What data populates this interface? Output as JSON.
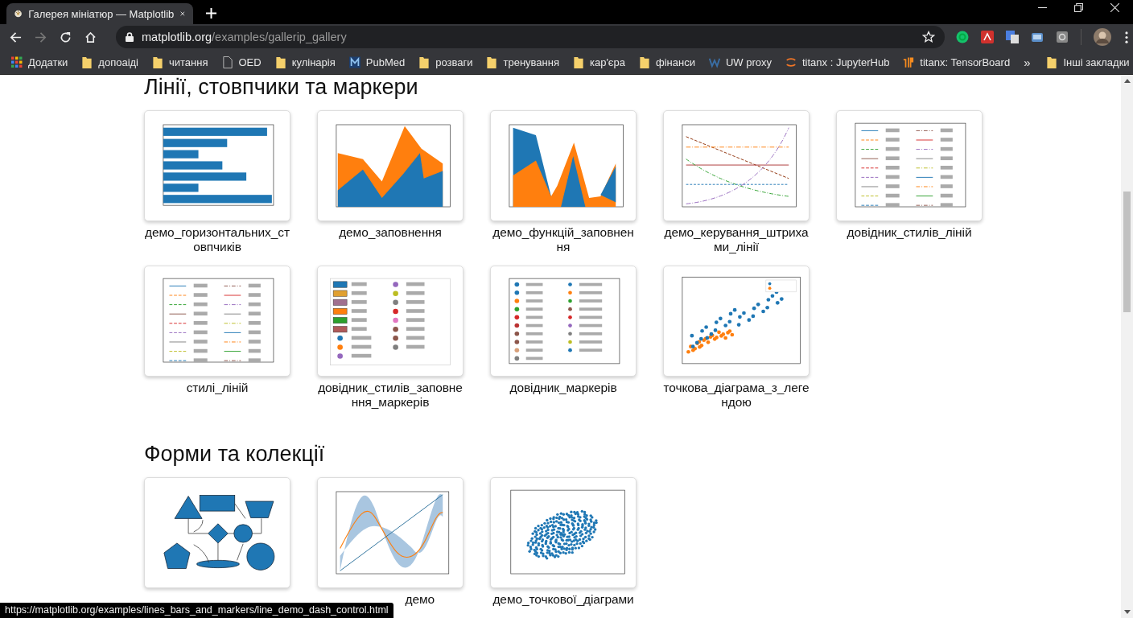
{
  "tab": {
    "title": "Галерея мініатюр — Matplotlib",
    "selected": true
  },
  "address": {
    "host": "matplotlib.org",
    "path": "/examples/gallerip_gallery"
  },
  "bookmarks": [
    {
      "kind": "apps",
      "label": "Додатки"
    },
    {
      "kind": "folder",
      "label": "допоаіді"
    },
    {
      "kind": "folder",
      "label": "читання"
    },
    {
      "kind": "page",
      "label": "OED"
    },
    {
      "kind": "folder",
      "label": "кулінарія"
    },
    {
      "kind": "pubmed",
      "label": "PubMed"
    },
    {
      "kind": "folder",
      "label": "розваги"
    },
    {
      "kind": "folder",
      "label": "тренування"
    },
    {
      "kind": "folder",
      "label": "кар'єра"
    },
    {
      "kind": "folder",
      "label": "фінанси"
    },
    {
      "kind": "w",
      "label": "UW proxy"
    },
    {
      "kind": "jupyter",
      "label": "titanx : JupyterHub"
    },
    {
      "kind": "tensorboard",
      "label": "titanx: TensorBoard"
    }
  ],
  "overflow": "»",
  "other_bookmarks": "Інші закладки",
  "sections": [
    {
      "heading": "Лінії, стовпчики та маркери",
      "items": [
        {
          "kind": "picture",
          "caption": "демо_горизонтальних_стовпчиків"
        },
        {
          "kind": "picture",
          "caption": "демо_заповнення"
        },
        {
          "kind": "picture",
          "caption": "демо_функцій_заповнення"
        },
        {
          "kind": "picture",
          "caption": "демо_керування_штрихами_лінії"
        },
        {
          "kind": "picture",
          "caption": "довідник_стилів_ліній"
        },
        {
          "kind": "picture",
          "caption": "стилі_ліній"
        },
        {
          "kind": "picture",
          "caption": "довідник_стилів_заповнення_маркерів"
        },
        {
          "kind": "picture",
          "caption": "довідник_маркерів"
        },
        {
          "kind": "picture",
          "caption": "точкова_діаграма_з_легендою"
        }
      ]
    },
    {
      "heading": "Форми та колекції",
      "items": [
        {
          "kind": "picture"
        },
        {
          "kind": "picture",
          "caption": "демо"
        },
        {
          "kind": "picture",
          "caption": "демо_точкової_діаграми"
        }
      ]
    }
  ],
  "status_url": "https://matplotlib.org/examples/lines_bars_and_markers/line_demo_dash_control.html"
}
